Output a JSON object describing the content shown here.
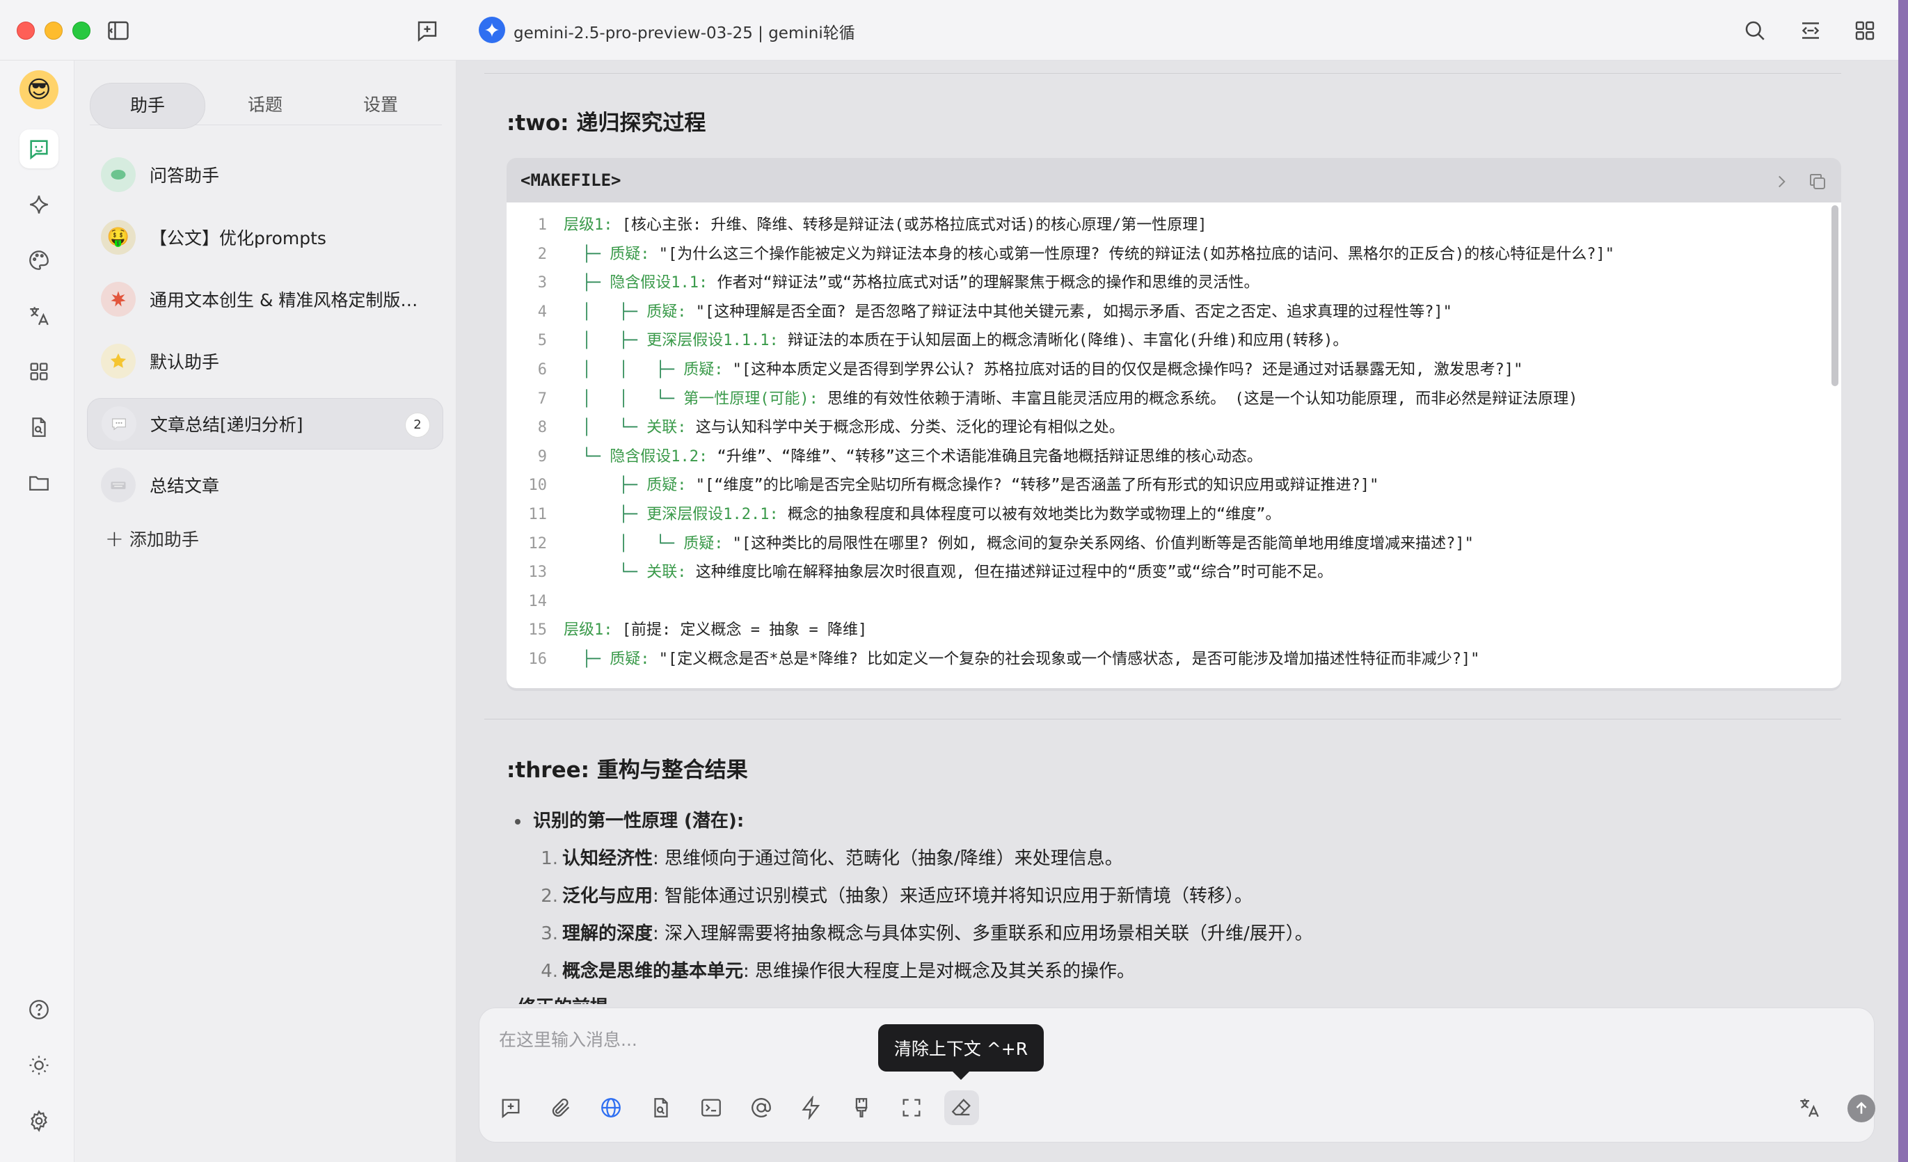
{
  "window": {
    "model_title": "gemini-2.5-pro-preview-03-25 | gemini轮循"
  },
  "sidebar": {
    "tabs": [
      "助手",
      "话题",
      "设置"
    ],
    "active_tab": "助手",
    "assistants": [
      {
        "label": "问答助手",
        "icon": "chat-bubble-icon",
        "badge": null
      },
      {
        "label": "【公文】优化prompts",
        "icon": "money-face-icon",
        "badge": null
      },
      {
        "label": "通用文本创生 & 精准风格定制版…",
        "icon": "sparkle-burst-icon",
        "badge": null
      },
      {
        "label": "默认助手",
        "icon": "star-icon",
        "badge": null
      },
      {
        "label": "文章总结[递归分析]",
        "icon": "speech-bubble-icon",
        "badge": "2"
      },
      {
        "label": "总结文章",
        "icon": "keyboard-icon",
        "badge": null
      }
    ],
    "add_label": "添加助手"
  },
  "main": {
    "section_two_title": ":two: 递归探究过程",
    "code": {
      "lang": "<MAKEFILE>",
      "lines": [
        {
          "n": "1",
          "tree": "",
          "key": "层级1:",
          "text": " [核心主张: 升维、降维、转移是辩证法(或苏格拉底式对话)的核心原理/第一性原理]"
        },
        {
          "n": "2",
          "tree": "  ├─ ",
          "key": "质疑:",
          "text": " \"[为什么这三个操作能被定义为辩证法本身的核心或第一性原理? 传统的辩证法(如苏格拉底的诘问、黑格尔的正反合)的核心特征是什么?]\""
        },
        {
          "n": "3",
          "tree": "  ├─ ",
          "key": "隐含假设1.1:",
          "text": " 作者对“辩证法”或“苏格拉底式对话”的理解聚焦于概念的操作和思维的灵活性。"
        },
        {
          "n": "4",
          "tree": "  │   ├─ ",
          "key": "质疑:",
          "text": " \"[这种理解是否全面? 是否忽略了辩证法中其他关键元素, 如揭示矛盾、否定之否定、追求真理的过程性等?]\""
        },
        {
          "n": "5",
          "tree": "  │   ├─ ",
          "key": "更深层假设1.1.1:",
          "text": " 辩证法的本质在于认知层面上的概念清晰化(降维)、丰富化(升维)和应用(转移)。"
        },
        {
          "n": "6",
          "tree": "  │   │   ├─ ",
          "key": "质疑:",
          "text": " \"[这种本质定义是否得到学界公认? 苏格拉底对话的目的仅仅是概念操作吗? 还是通过对话暴露无知, 激发思考?]\""
        },
        {
          "n": "7",
          "tree": "  │   │   └─ ",
          "key": "第一性原理(可能):",
          "text": " 思维的有效性依赖于清晰、丰富且能灵活应用的概念系统。 (这是一个认知功能原理, 而非必然是辩证法原理)"
        },
        {
          "n": "8",
          "tree": "  │   └─ ",
          "key": "关联:",
          "text": " 这与认知科学中关于概念形成、分类、泛化的理论有相似之处。"
        },
        {
          "n": "9",
          "tree": "  └─ ",
          "key": "隐含假设1.2:",
          "text": " “升维”、“降维”、“转移”这三个术语能准确且完备地概括辩证思维的核心动态。"
        },
        {
          "n": "10",
          "tree": "      ├─ ",
          "key": "质疑:",
          "text": " \"[“维度”的比喻是否完全贴切所有概念操作? “转移”是否涵盖了所有形式的知识应用或辩证推进?]\""
        },
        {
          "n": "11",
          "tree": "      ├─ ",
          "key": "更深层假设1.2.1:",
          "text": " 概念的抽象程度和具体程度可以被有效地类比为数学或物理上的“维度”。"
        },
        {
          "n": "12",
          "tree": "      │   └─ ",
          "key": "质疑:",
          "text": " \"[这种类比的局限性在哪里? 例如, 概念间的复杂关系网络、价值判断等是否能简单地用维度增减来描述?]\""
        },
        {
          "n": "13",
          "tree": "      └─ ",
          "key": "关联:",
          "text": " 这种维度比喻在解释抽象层次时很直观, 但在描述辩证过程中的“质变”或“综合”时可能不足。"
        },
        {
          "n": "14",
          "tree": "",
          "key": "",
          "text": ""
        },
        {
          "n": "15",
          "tree": "",
          "key": "层级1:",
          "text": " [前提: 定义概念 = 抽象 = 降维]"
        },
        {
          "n": "16",
          "tree": "  ├─ ",
          "key": "质疑:",
          "text": " \"[定义概念是否*总是*降维? 比如定义一个复杂的社会现象或一个情感状态, 是否可能涉及增加描述性特征而非减少?]\""
        }
      ]
    },
    "section_three_title": ":three: 重构与整合结果",
    "bullet_title": "识别的第一性原理 (潜在):",
    "principles": [
      {
        "num": "1.",
        "term": "认知经济性",
        "desc": ": 思维倾向于通过简化、范畴化（抽象/降维）来处理信息。"
      },
      {
        "num": "2.",
        "term": "泛化与应用",
        "desc": ": 智能体通过识别模式（抽象）来适应环境并将知识应用于新情境（转移）。"
      },
      {
        "num": "3.",
        "term": "理解的深度",
        "desc": ": 深入理解需要将抽象概念与具体实例、多重联系和应用场景相关联（升维/展开）。"
      },
      {
        "num": "4.",
        "term": "概念是思维的基本单元",
        "desc": ": 思维操作很大程度上是对概念及其关系的操作。"
      }
    ],
    "cut_text": "修正的前提"
  },
  "input": {
    "placeholder": "在这里输入消息...",
    "tooltip": "清除上下文 ^+R"
  }
}
